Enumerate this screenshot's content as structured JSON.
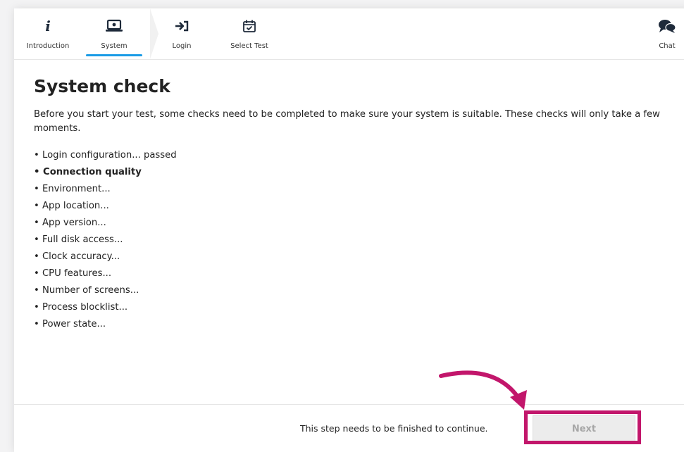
{
  "nav": {
    "items": [
      {
        "label": "Introduction",
        "icon": "info-icon"
      },
      {
        "label": "System",
        "icon": "laptop-icon",
        "active": true
      },
      {
        "label": "Login",
        "icon": "login-icon"
      },
      {
        "label": "Select Test",
        "icon": "calendar-check-icon"
      }
    ],
    "chat_label": "Chat",
    "chat_icon": "chat-icon",
    "active_color": "#1a9be6"
  },
  "page": {
    "title": "System check",
    "intro": "Before you start your test, some checks need to be completed to make sure your system is suitable. These checks will only take a few moments.",
    "checks": [
      "• Login configuration... passed",
      "• Connection quality",
      "• Environment...",
      "• App location...",
      "• App version...",
      "• Full disk access...",
      "• Clock accuracy...",
      "• CPU features...",
      "• Number of screens...",
      "• Process blocklist...",
      "• Power state..."
    ]
  },
  "footer": {
    "message": "This step needs to be finished to continue.",
    "next_label": "Next"
  },
  "annotation": {
    "color": "#c2166b"
  }
}
